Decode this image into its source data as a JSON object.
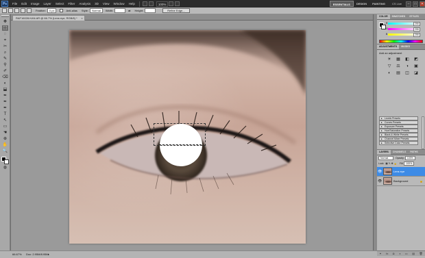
{
  "app": {
    "logo": "Ps",
    "menu": [
      "File",
      "Edit",
      "Image",
      "Layer",
      "Select",
      "Filter",
      "Analysis",
      "3D",
      "View",
      "Window",
      "Help"
    ],
    "zoom_select": "100%",
    "workspaces": [
      "ESSENTIALS",
      "DESIGN",
      "PAINTING"
    ],
    "active_workspace": "ESSENTIALS",
    "cs_live": "CS Live",
    "window_controls": [
      "–",
      "□",
      "✕"
    ]
  },
  "options": {
    "feather_label": "Feather:",
    "feather_value": "0 px",
    "antialias_label": "Anti-alias",
    "style_label": "Style:",
    "style_value": "Normal",
    "width_label": "Width:",
    "height_label": "Height:",
    "refine_button": "Refine Edge..."
  },
  "document": {
    "tab_title": "RAF16028.KAN.AR @ 66.7% (Lens eye, RGB/8) *",
    "close": "×"
  },
  "status": {
    "zoom": "66.67%",
    "doc_size": "Doc: 2.95M/8.95M",
    "arrow": "▸"
  },
  "tools": [
    "⬚",
    "✥",
    "◌",
    "⌖",
    "✂",
    "⌕",
    "✎",
    "⚲",
    "✐",
    "⌫",
    "◐",
    "⬓",
    "✒",
    "T",
    "↖",
    "▭",
    "☚",
    "⊕",
    "✋",
    "🔍"
  ],
  "panels": {
    "top_tabs": [
      "COLOR",
      "SWATCHES",
      "STYLES"
    ],
    "color": {
      "channels": [
        {
          "label": "R",
          "value": "255"
        },
        {
          "label": "G",
          "value": "255"
        },
        {
          "label": "B",
          "value": "255"
        }
      ]
    },
    "adjust_tabs": [
      "ADJUSTMENTS",
      "MASKS"
    ],
    "adjust_title": "Add an adjustment",
    "adjust_icons": [
      "☀",
      "▦",
      "◧",
      "◩",
      "▽",
      "⚖",
      "◑",
      "▣",
      "◐",
      "▤",
      "◫",
      "◪"
    ],
    "presets": [
      "Levels Presets",
      "Curves Presets",
      "Exposure Presets",
      "Hue/Saturation Presets",
      "Black & White Presets",
      "Channel Mixer Presets",
      "Selective Color Presets"
    ],
    "layers_tabs": [
      "LAYERS",
      "CHANNELS",
      "PATHS"
    ],
    "blend_mode": "Normal",
    "opacity_label": "Opacity:",
    "opacity_value": "100%",
    "lock_label": "Lock:",
    "fill_label": "Fill:",
    "fill_value": "100%",
    "layers": [
      {
        "name": "Lens eye",
        "selected": true,
        "locked": false
      },
      {
        "name": "Background",
        "selected": false,
        "locked": true
      }
    ],
    "footer_icons": [
      "⚭",
      "fx",
      "◘",
      "◑",
      "▭",
      "▤",
      "🗑"
    ]
  },
  "colors": {
    "menu_bg": "#2b2b2b",
    "selected_layer": "#3d8be6",
    "canvas_bg": "#9a9a9a"
  }
}
